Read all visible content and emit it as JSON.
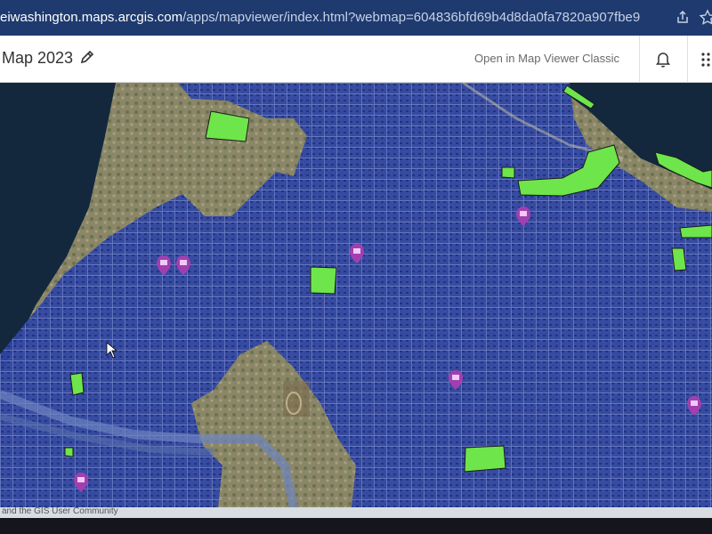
{
  "browser": {
    "url_host": "eiwashington.maps.arcgis.com",
    "url_path": "/apps/mapviewer/index.html?webmap=604836bfd69b4d8da0fa7820a907fbe9"
  },
  "header": {
    "title": "Map 2023",
    "classic_link": "Open in Map Viewer Classic"
  },
  "map": {
    "attribution": "and the GIS User Community",
    "colors": {
      "water": "#13283d",
      "land": "#8c8a6c",
      "overlay": "#2f47a6",
      "polygon": "#6ee54b",
      "marker": "#a23fb0"
    }
  }
}
